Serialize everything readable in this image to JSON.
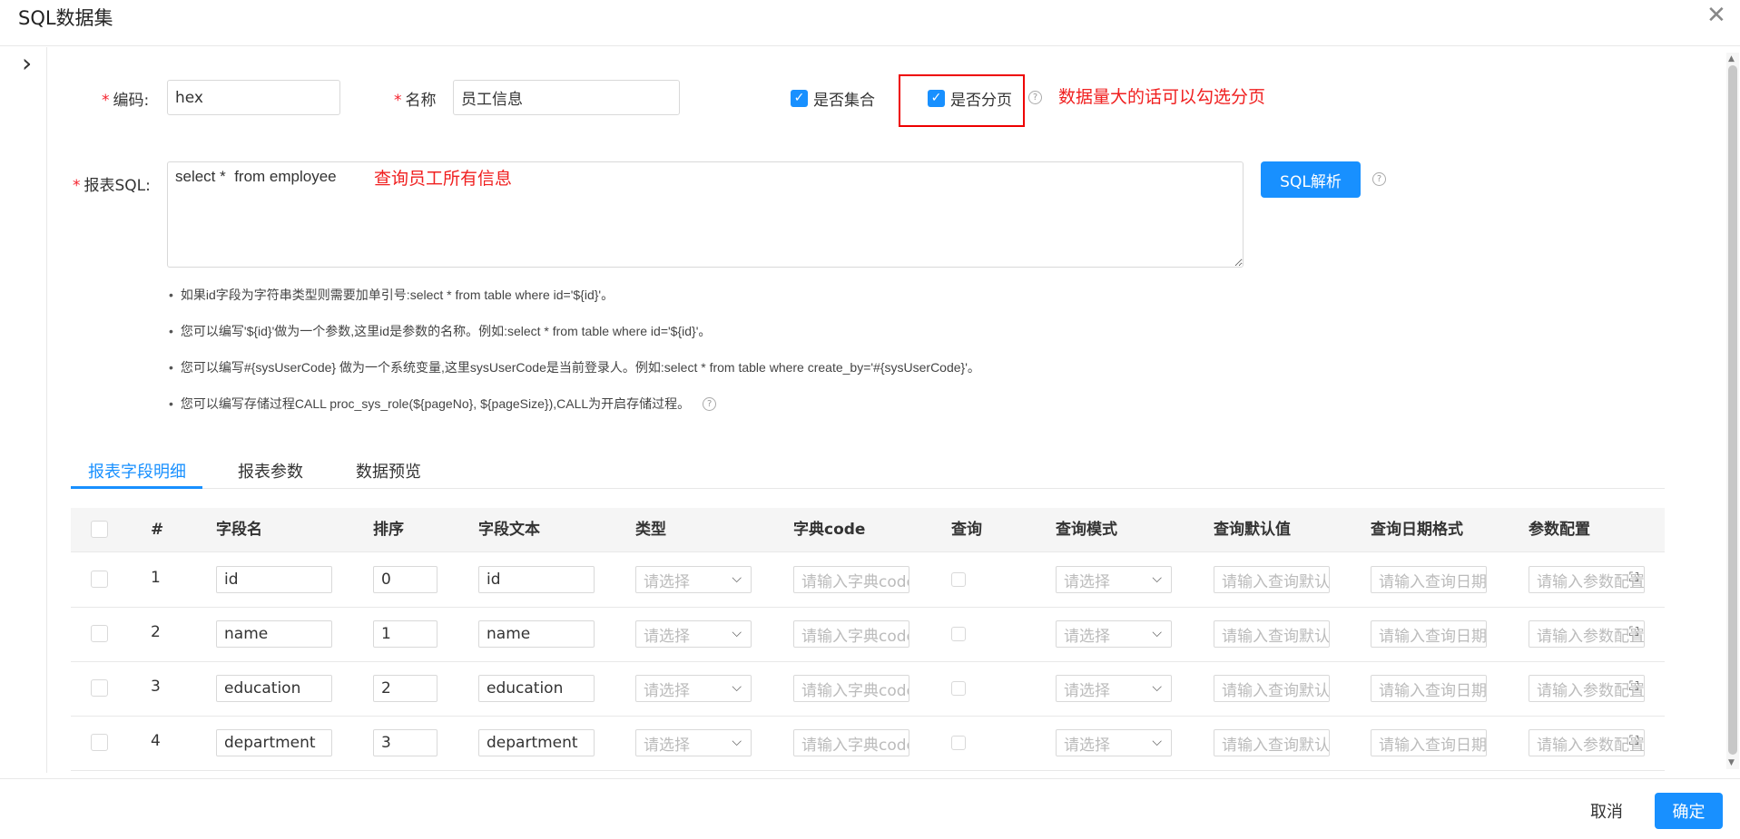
{
  "dialog": {
    "title": "SQL数据集",
    "close_glyph": "✕",
    "collapse_glyph": "›"
  },
  "form": {
    "code_label": "编码:",
    "code_value": "hex",
    "name_label": "名称",
    "name_value": "员工信息",
    "is_collection_label": "是否集合",
    "is_paging_label": "是否分页",
    "sql_label": "报表SQL:",
    "sql_value": "select *  from employee",
    "parse_button": "SQL解析",
    "required_mark": "*"
  },
  "annotations": {
    "paging_note": "数据量大的话可以勾选分页",
    "sql_note": "查询员工所有信息"
  },
  "tips": [
    "如果id字段为字符串类型则需要加单引号:select * from table where id='${id}'。",
    "您可以编写'${id}'做为一个参数,这里id是参数的名称。例如:select * from table where id='${id}'。",
    "您可以编写#{sysUserCode} 做为一个系统变量,这里sysUserCode是当前登录人。例如:select * from table where create_by='#{sysUserCode}'。",
    "您可以编写存储过程CALL proc_sys_role(${pageNo}, ${pageSize}),CALL为开启存储过程。"
  ],
  "tabs": [
    {
      "label": "报表字段明细",
      "active": true
    },
    {
      "label": "报表参数",
      "active": false
    },
    {
      "label": "数据预览",
      "active": false
    }
  ],
  "table": {
    "headers": [
      "#",
      "字段名",
      "排序",
      "字段文本",
      "类型",
      "字典code",
      "查询",
      "查询模式",
      "查询默认值",
      "查询日期格式",
      "参数配置"
    ],
    "placeholders": {
      "type": "请选择",
      "dict_code": "请输入字典code",
      "query_mode": "请选择",
      "default_value": "请输入查询默认值",
      "date_format": "请输入查询日期格式",
      "param_config": "请输入参数配置"
    },
    "rows": [
      {
        "index": "1",
        "field_name": "id",
        "order": "0",
        "field_text": "id"
      },
      {
        "index": "2",
        "field_name": "name",
        "order": "1",
        "field_text": "name"
      },
      {
        "index": "3",
        "field_name": "education",
        "order": "2",
        "field_text": "education"
      },
      {
        "index": "4",
        "field_name": "department",
        "order": "3",
        "field_text": "department"
      }
    ]
  },
  "footer": {
    "cancel": "取消",
    "confirm": "确定"
  },
  "colors": {
    "primary": "#1890ff",
    "annotation_red": "#f02020",
    "required_red": "#f5222d"
  }
}
